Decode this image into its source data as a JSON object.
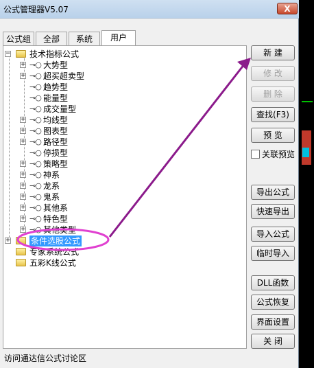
{
  "window": {
    "title": "公式管理器V5.07",
    "close_label": "X"
  },
  "tabs": [
    "公式组",
    "全部",
    "系统",
    "用户"
  ],
  "active_tab": "用户",
  "tree": {
    "root": "技术指标公式",
    "children": [
      "大势型",
      "超买超卖型",
      "趋势型",
      "能量型",
      "成交量型",
      "均线型",
      "图表型",
      "路径型",
      "停损型",
      "策略型",
      "神系",
      "龙系",
      "鬼系",
      "其他系",
      "特色型",
      "其他类型"
    ],
    "others": [
      "条件选股公式",
      "专家系统公式",
      "五彩K线公式"
    ],
    "selected": "条件选股公式"
  },
  "buttons": {
    "new": "新  建",
    "modify": "修  改",
    "delete": "删  除",
    "find": "查找(F3)",
    "preview": "预  览",
    "link_preview": "关联预览",
    "export": "导出公式",
    "quick_export": "快速导出",
    "import": "导入公式",
    "temp_import": "临时导入",
    "dll": "DLL函数",
    "restore": "公式恢复",
    "ui_settings": "界面设置",
    "close": "关  闭"
  },
  "footer": "访问通达信公式讨论区",
  "colors": {
    "annotation": "#8b1a8b",
    "highlight_ellipse": "#e040d0",
    "selection": "#3399ff"
  }
}
